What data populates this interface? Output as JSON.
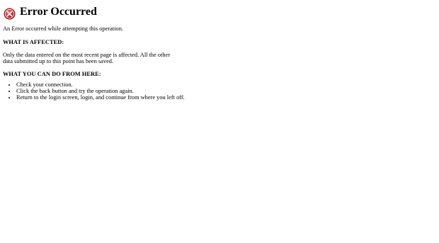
{
  "error_page": {
    "icon": "error-x-icon",
    "icon_color": "#cc2222",
    "title": "Error Occurred",
    "intro": "An Error occurred while attempting this operation.",
    "affected_heading": "WHAT IS AFFECTED:",
    "affected_text": "Only the data entered on the most recent page is affected. All the other data submitted up to this point has been saved.",
    "actions_heading": "WHAT YOU CAN DO FROM HERE:",
    "actions": [
      "Check your connection.",
      "Click the back button and try the operation again.",
      "Return to the login screen, login, and continue from where you left off."
    ]
  }
}
